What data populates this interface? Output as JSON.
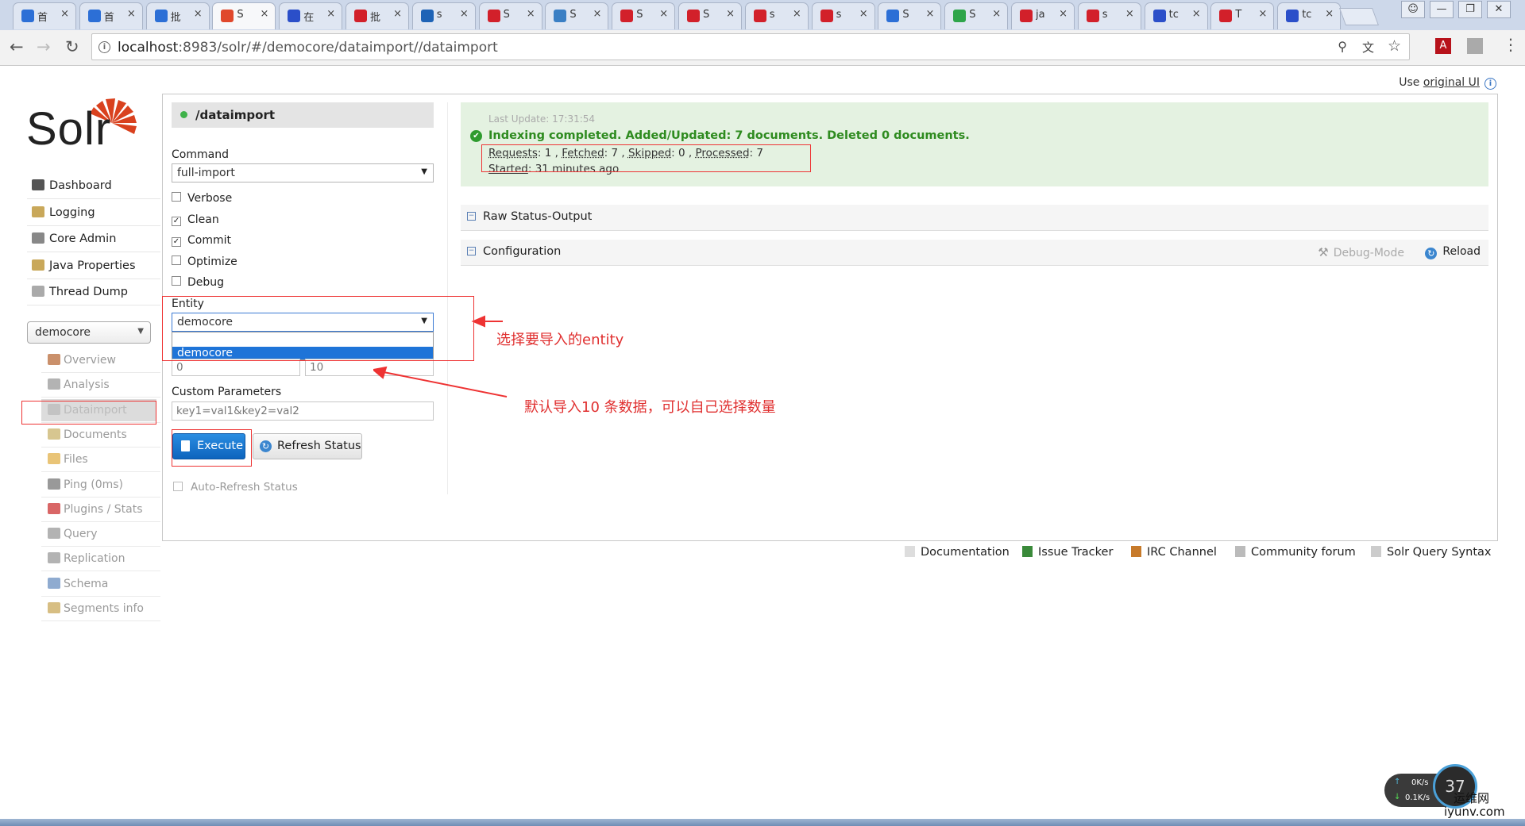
{
  "browser": {
    "tabs": [
      {
        "icon_color": "#2c6fd6",
        "text": "首"
      },
      {
        "icon_color": "#2c6fd6",
        "text": "首"
      },
      {
        "icon_color": "#2c6fd6",
        "text": "批"
      },
      {
        "icon_color": "#e0482c",
        "text": "S",
        "active": true
      },
      {
        "icon_color": "#2b4fc9",
        "text": "在"
      },
      {
        "icon_color": "#d2202a",
        "text": "批"
      },
      {
        "icon_color": "#1e63b6",
        "text": "s"
      },
      {
        "icon_color": "#d2202a",
        "text": "S"
      },
      {
        "icon_color": "#3a7fc4",
        "text": "S"
      },
      {
        "icon_color": "#d2202a",
        "text": "S"
      },
      {
        "icon_color": "#d2202a",
        "text": "S"
      },
      {
        "icon_color": "#d2202a",
        "text": "s"
      },
      {
        "icon_color": "#d2202a",
        "text": "s"
      },
      {
        "icon_color": "#2c6fd6",
        "text": "S"
      },
      {
        "icon_color": "#2ea54a",
        "text": "S"
      },
      {
        "icon_color": "#d2202a",
        "text": "ja"
      },
      {
        "icon_color": "#d2202a",
        "text": "s"
      },
      {
        "icon_color": "#2b4fc9",
        "text": "tc"
      },
      {
        "icon_color": "#d2202a",
        "text": "T"
      },
      {
        "icon_color": "#2b4fc9",
        "text": "tc"
      }
    ],
    "tab_close": "×",
    "url_host": "localhost",
    "url_rest": ":8983/solr/#/democore/dataimport//dataimport",
    "nav": {
      "back": "←",
      "forward": "→",
      "reload": "↻"
    }
  },
  "solr": {
    "use_original_prefix": "Use ",
    "use_original_link": "original UI",
    "logo_text": "Solr",
    "main_nav": [
      {
        "label": "Dashboard",
        "icon": "dashboard-icon",
        "color": "#555"
      },
      {
        "label": "Logging",
        "icon": "logging-icon",
        "color": "#c9a85a"
      },
      {
        "label": "Core Admin",
        "icon": "core-admin-icon",
        "color": "#888"
      },
      {
        "label": "Java Properties",
        "icon": "java-properties-icon",
        "color": "#c9a85a"
      },
      {
        "label": "Thread Dump",
        "icon": "thread-dump-icon",
        "color": "#aaa"
      }
    ],
    "core_selected": "democore",
    "core_nav": [
      {
        "label": "Overview",
        "icon": "home-icon",
        "color": "#b86b3a"
      },
      {
        "label": "Analysis",
        "icon": "analysis-icon",
        "color": "#999"
      },
      {
        "label": "Dataimport",
        "icon": "dataimport-icon",
        "color": "#bbb",
        "active": true
      },
      {
        "label": "Documents",
        "icon": "documents-icon",
        "color": "#c9b36b"
      },
      {
        "label": "Files",
        "icon": "files-icon",
        "color": "#e2b04a"
      },
      {
        "label": "Ping (0ms)",
        "icon": "ping-icon",
        "color": "#777"
      },
      {
        "label": "Plugins / Stats",
        "icon": "plugins-icon",
        "color": "#c33"
      },
      {
        "label": "Query",
        "icon": "query-icon",
        "color": "#999"
      },
      {
        "label": "Replication",
        "icon": "replication-icon",
        "color": "#999"
      },
      {
        "label": "Schema",
        "icon": "schema-icon",
        "color": "#6a8fc0"
      },
      {
        "label": "Segments info",
        "icon": "segments-icon",
        "color": "#c9a85a"
      }
    ],
    "handler": "/dataimport",
    "command_label": "Command",
    "command_value": "full-import",
    "options": [
      {
        "label": "Verbose",
        "checked": false
      },
      {
        "label": "Clean",
        "checked": true
      },
      {
        "label": "Commit",
        "checked": true
      },
      {
        "label": "Optimize",
        "checked": false
      },
      {
        "label": "Debug",
        "checked": false
      }
    ],
    "entity_label": "Entity",
    "entity_value": "democore",
    "entity_option": "democore",
    "start_value": "0",
    "rows_value": "10",
    "custom_params_label": "Custom Parameters",
    "custom_params_value": "key1=val1&key2=val2",
    "execute_label": "Execute",
    "refresh_label": "Refresh Status",
    "auto_refresh_label": "Auto-Refresh Status",
    "status": {
      "last_update": "Last Update: 17:31:54",
      "message": "Indexing completed. Added/Updated: 7 documents. Deleted 0 documents.",
      "requests_label": "Requests",
      "requests": "1",
      "fetched_label": "Fetched",
      "fetched": "7",
      "skipped_label": "Skipped",
      "skipped": "0",
      "processed_label": "Processed",
      "processed": "7",
      "started_label": "Started",
      "started": "31 minutes ago"
    },
    "raw_status_label": "Raw Status-Output",
    "configuration_label": "Configuration",
    "debug_mode_label": "Debug-Mode",
    "reload_label": "Reload",
    "footer": [
      {
        "label": "Documentation",
        "icon": "documentation-icon"
      },
      {
        "label": "Issue Tracker",
        "icon": "bug-icon"
      },
      {
        "label": "IRC Channel",
        "icon": "irc-icon"
      },
      {
        "label": "Community forum",
        "icon": "forum-icon"
      },
      {
        "label": "Solr Query Syntax",
        "icon": "query-syntax-icon"
      }
    ]
  },
  "annotations": {
    "entity_note": "选择要导入的entity",
    "rows_note": "默认导入10 条数据，可以自己选择数量"
  },
  "widget": {
    "up_speed": "0K/s",
    "down_speed": "0.1K/s",
    "percent": "37",
    "watermark_line1": "运维网",
    "watermark_line2": "iyunv.com"
  }
}
